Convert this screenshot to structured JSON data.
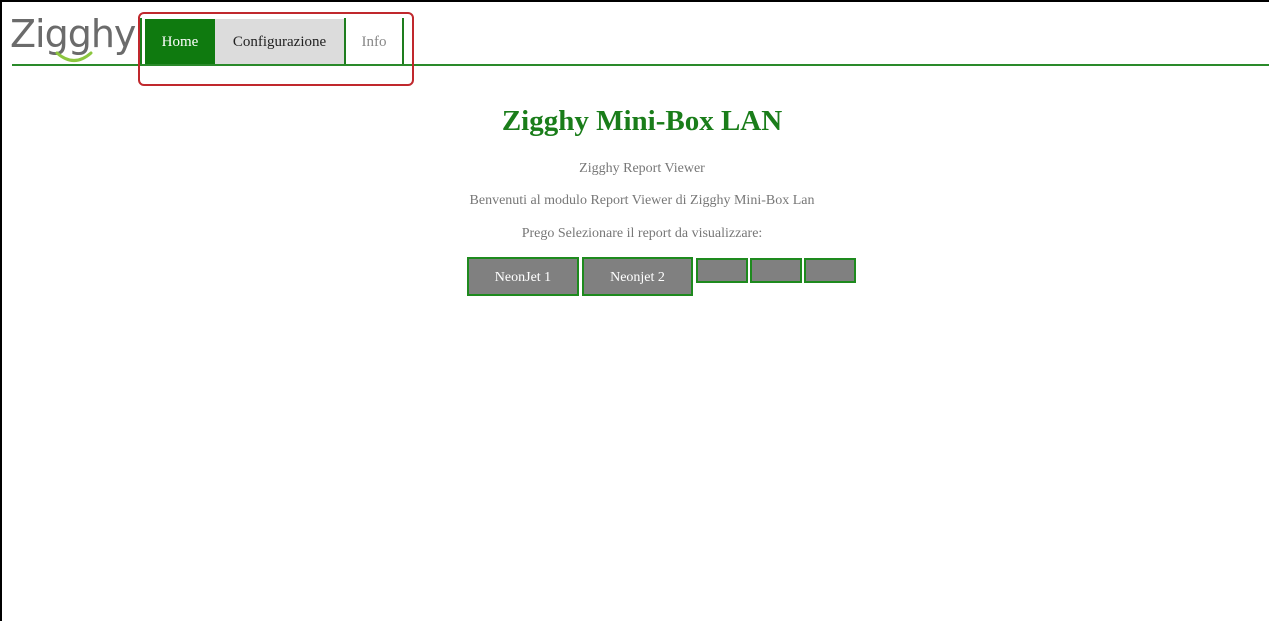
{
  "app": {
    "logo_text": "Zigghy"
  },
  "nav": {
    "items": [
      {
        "label": "Home",
        "active": true
      },
      {
        "label": "Configurazione",
        "active": false
      },
      {
        "label": "Info",
        "active": false
      }
    ]
  },
  "main": {
    "title": "Zigghy Mini-Box LAN",
    "subtitle": "Zigghy Report Viewer",
    "welcome": "Benvenuti al modulo Report Viewer di Zigghy Mini-Box Lan",
    "prompt": "Prego Selezionare il report da visualizzare:"
  },
  "reports": [
    {
      "label": "NeonJet 1"
    },
    {
      "label": "Neonjet 2"
    },
    {
      "label": ""
    },
    {
      "label": ""
    },
    {
      "label": ""
    }
  ],
  "colors": {
    "brand_green": "#0f7a0f",
    "title_green": "#1a7d1a",
    "button_gray": "#808080",
    "highlight_red": "#c0282d"
  }
}
